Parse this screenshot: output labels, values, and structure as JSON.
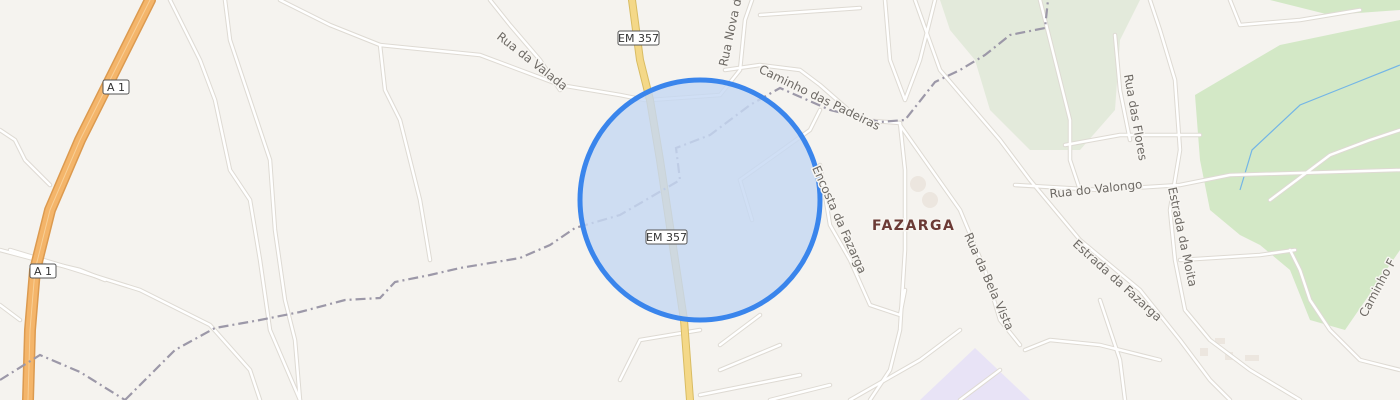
{
  "map": {
    "place_label": "FAZARGA",
    "road_labels": {
      "rua_da_valada": "Rua da Valada",
      "rua_nova_da": "Rua Nova da",
      "caminho_das_padeiras": "Caminho das Padeiras",
      "encosta_da_fazarga": "Encosta da Fazarga",
      "rua_da_bela_vista": "Rua da Bela Vista",
      "rua_do_valongo": "Rua do Valongo",
      "estrada_da_fazarga": "Estrada da Fazarga",
      "rua_das_flores": "Rua das Flores",
      "estrada_da_moita": "Estrada da Moita",
      "caminho_f": "Caminho F"
    },
    "shields": {
      "em357_top": "EM 357",
      "em357_mid": "EM 357",
      "a1_top": "A 1",
      "a1_bottom": "A 1"
    },
    "colors": {
      "background": "#f5f3ef",
      "minor_road": "#ffffff",
      "road_casing": "#e2ded8",
      "motorway": "#f3b46a",
      "primary_road": "#f4d88a",
      "boundary": "#9c98a8",
      "park": "#dfe9d3",
      "forest": "#cfe6c1",
      "water": "#6fb3e8",
      "location_accuracy_fill": "#ccdcf2",
      "location_accuracy_stroke": "#3a85ec",
      "industrial": "#e9e3f5"
    }
  }
}
